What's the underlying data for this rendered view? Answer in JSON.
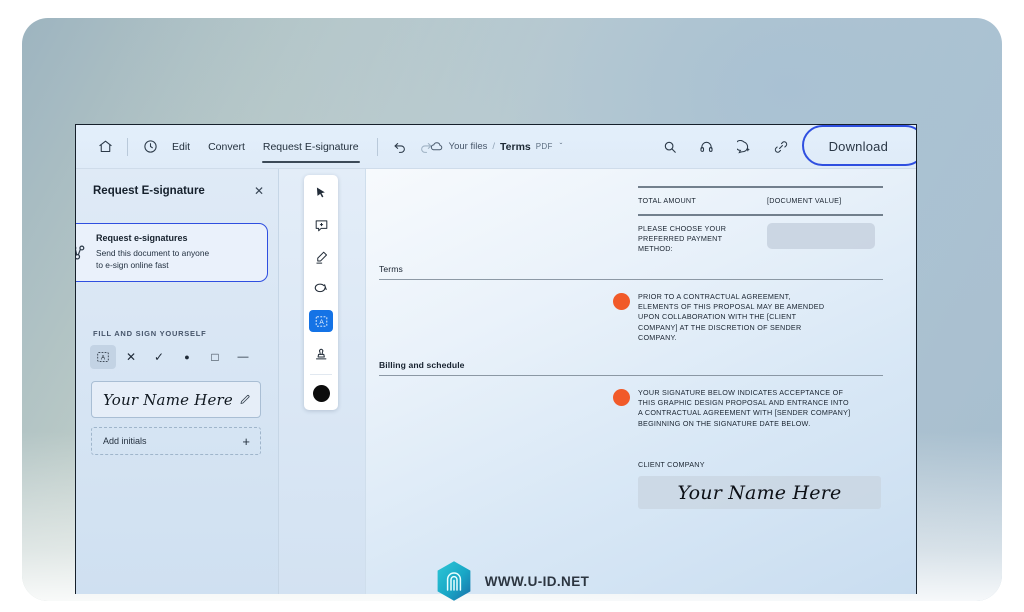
{
  "toolbar": {
    "home_icon": "home-icon",
    "recent_icon": "clock-icon",
    "items": [
      {
        "label": "Edit",
        "active": false
      },
      {
        "label": "Convert",
        "active": false
      },
      {
        "label": "Request E-signature",
        "active": true
      }
    ],
    "undo_label": "↩",
    "redo_label": "↪",
    "breadcrumb": {
      "cloud_icon": "cloud-icon",
      "root": "Your files",
      "separator": "/",
      "file": "Terms",
      "filetype": "PDF",
      "chevron": "ˇ"
    },
    "right_icons": [
      "search-icon",
      "headphones-icon",
      "comment-add-icon",
      "link-icon"
    ],
    "download_label": "Download"
  },
  "left_panel": {
    "title": "Request E-signature",
    "close_label": "✕",
    "esign_card": {
      "icon": "people-share-icon",
      "title": "Request e-signatures",
      "subtitle": "Send this document to anyone\nto e-sign online fast"
    },
    "section_label": "FILL AND SIGN YOURSELF",
    "fill_tools": [
      {
        "name": "text-box-tool",
        "glyph": "A",
        "selected": true
      },
      {
        "name": "cross-tool",
        "glyph": "✕",
        "selected": false
      },
      {
        "name": "check-tool",
        "glyph": "✓",
        "selected": false
      },
      {
        "name": "dot-tool",
        "glyph": "●",
        "selected": false
      },
      {
        "name": "rectangle-tool",
        "glyph": "□",
        "selected": false
      },
      {
        "name": "line-tool",
        "glyph": "—",
        "selected": false
      }
    ],
    "signature_value": "Your Name Here",
    "signature_edit_icon": "pencil-icon",
    "add_initials_label": "Add initials",
    "add_initials_plus": "+"
  },
  "tool_rail": {
    "tools": [
      {
        "name": "select-cursor-tool",
        "selected": false
      },
      {
        "name": "comment-note-tool",
        "selected": false
      },
      {
        "name": "highlighter-pen-tool",
        "selected": false
      },
      {
        "name": "eraser-lasso-tool",
        "selected": false
      },
      {
        "name": "text-box-tool",
        "selected": true
      },
      {
        "name": "stamp-tool",
        "selected": false
      }
    ],
    "color_swatch": "#0c0c0c"
  },
  "document": {
    "total_amount_label": "TOTAL AMOUNT",
    "total_amount_value": "[DOCUMENT VALUE]",
    "payment_prompt": "PLEASE CHOOSE YOUR\nPREFERRED PAYMENT\nMETHOD:",
    "sections": [
      {
        "heading": "Terms"
      },
      {
        "heading": "Billing and schedule"
      }
    ],
    "clause_one": "PRIOR TO A CONTRACTUAL AGREEMENT,\nELEMENTS OF THIS PROPOSAL MAY BE AMENDED\nUPON COLLABORATION WITH THE [CLIENT\nCOMPANY] AT THE DISCRETION OF SENDER\nCOMPANY.",
    "clause_two": "YOUR SIGNATURE BELOW INDICATES ACCEPTANCE OF\nTHIS GRAPHIC DESIGN PROPOSAL AND ENTRANCE INTO\nA CONTRACTUAL AGREEMENT WITH [SENDER COMPANY]\nBEGINNING ON THE SIGNATURE DATE BELOW.",
    "client_company_label": "CLIENT COMPANY",
    "signature_value": "Your Name Here",
    "bullet_color": "#f15a29"
  },
  "watermark": {
    "logo_icon": "fingerprint-hexagon-logo",
    "text": "WWW.U-ID.NET"
  },
  "colors": {
    "accent_blue": "#2f4fe0",
    "tool_selected": "#1473e6",
    "bullet_orange": "#f15a29"
  }
}
